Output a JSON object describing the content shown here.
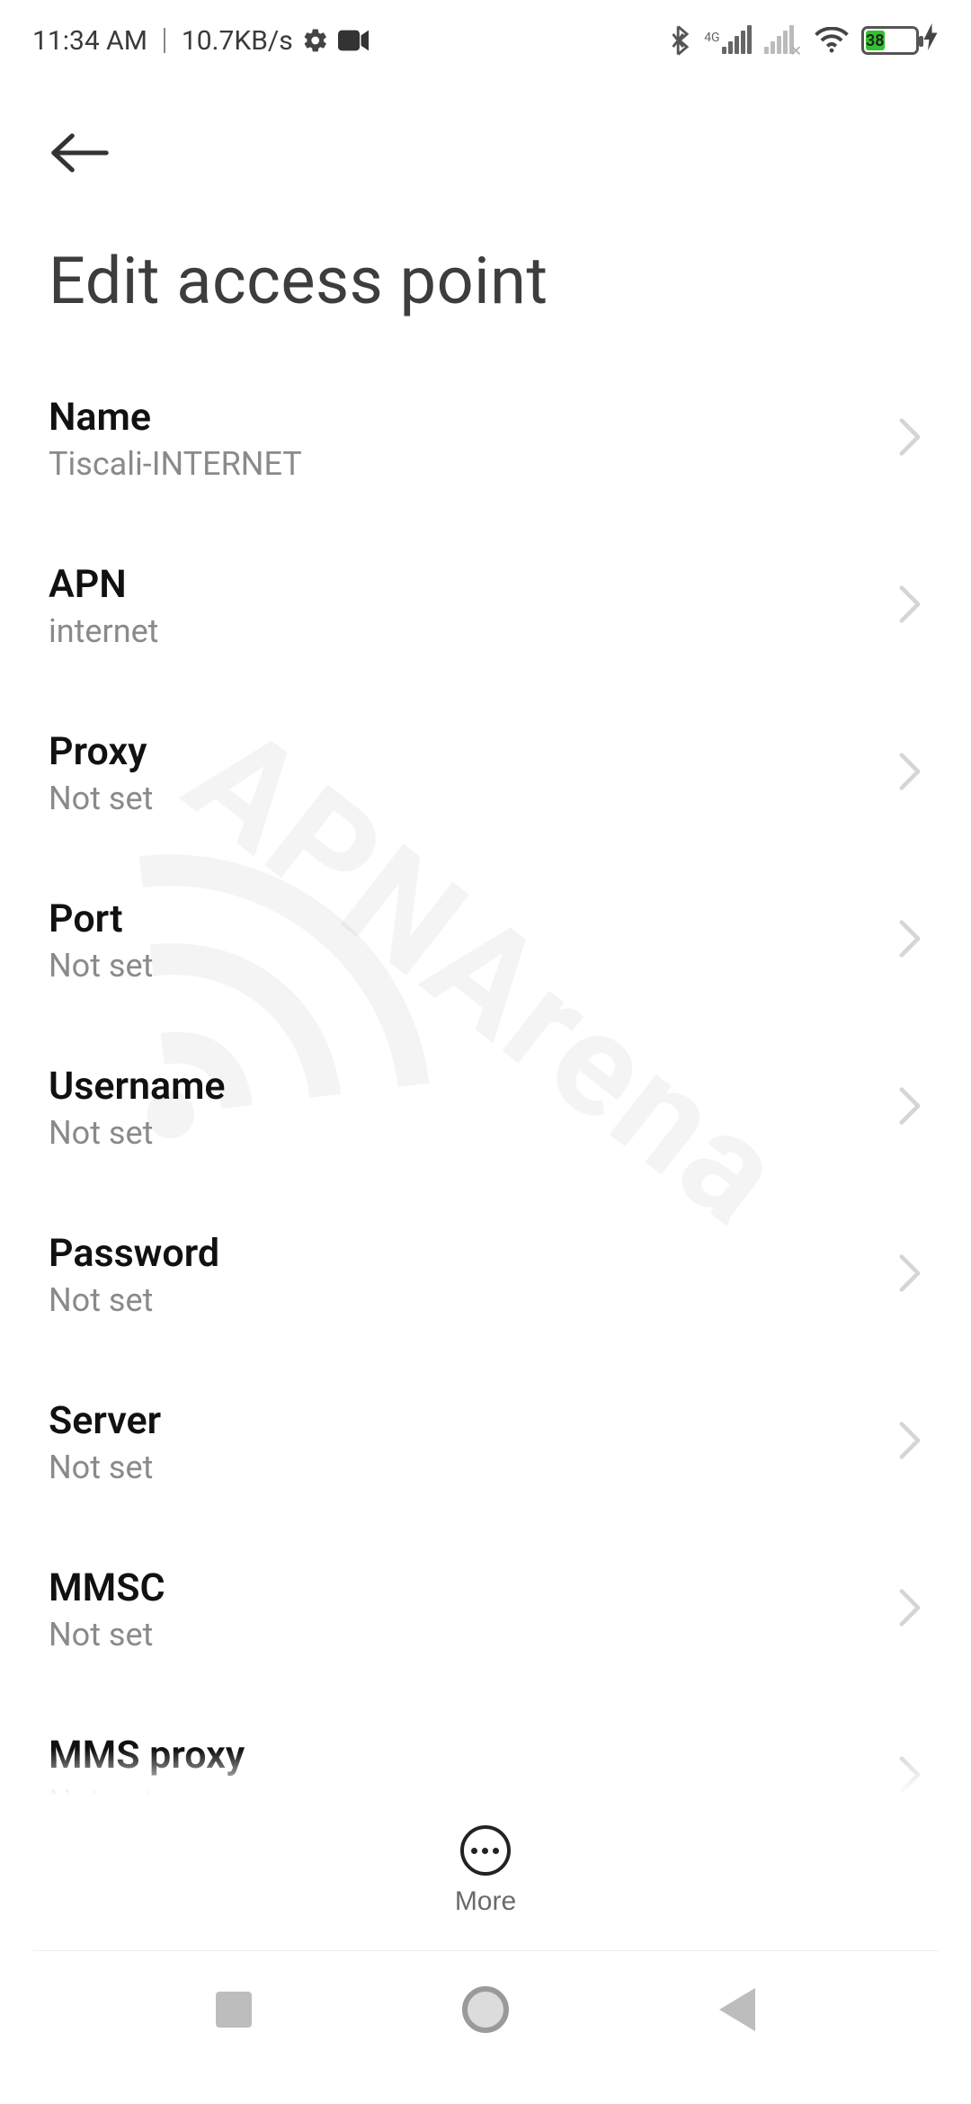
{
  "status_bar": {
    "time": "11:34 AM",
    "data_rate": "10.7KB/s",
    "battery_percent": 38,
    "battery_charging": true,
    "signal_label": "4G"
  },
  "header": {
    "title": "Edit access point"
  },
  "settings": [
    {
      "key": "name",
      "label": "Name",
      "value": "Tiscali-INTERNET"
    },
    {
      "key": "apn",
      "label": "APN",
      "value": "internet"
    },
    {
      "key": "proxy",
      "label": "Proxy",
      "value": "Not set"
    },
    {
      "key": "port",
      "label": "Port",
      "value": "Not set"
    },
    {
      "key": "username",
      "label": "Username",
      "value": "Not set"
    },
    {
      "key": "password",
      "label": "Password",
      "value": "Not set"
    },
    {
      "key": "server",
      "label": "Server",
      "value": "Not set"
    },
    {
      "key": "mmsc",
      "label": "MMSC",
      "value": "Not set"
    },
    {
      "key": "mms_proxy",
      "label": "MMS proxy",
      "value": "Not set"
    }
  ],
  "bottom_action": {
    "more_label": "More"
  },
  "watermark": {
    "text": "APNArena"
  }
}
